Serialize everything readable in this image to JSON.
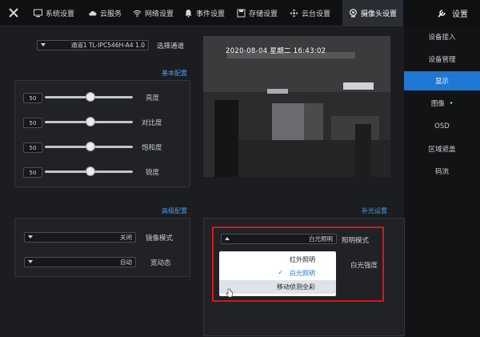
{
  "window": {
    "title": "设置"
  },
  "tabs": [
    {
      "label": "摄像头设置",
      "icon": "camera-icon",
      "active": true
    },
    {
      "label": "云台设置",
      "icon": "ptz-icon",
      "active": false
    },
    {
      "label": "存储设置",
      "icon": "storage-icon",
      "active": false
    },
    {
      "label": "事件设置",
      "icon": "bell-icon",
      "active": false
    },
    {
      "label": "网络设置",
      "icon": "wifi-icon",
      "active": false
    },
    {
      "label": "云服务",
      "icon": "cloud-icon",
      "active": false
    },
    {
      "label": "系统设置",
      "icon": "monitor-icon",
      "active": false
    }
  ],
  "sidebar": {
    "items": [
      {
        "label": "设备接入",
        "active": false
      },
      {
        "label": "设备管理",
        "active": false
      },
      {
        "label": "显示",
        "active": true
      },
      {
        "label": "图像",
        "active": false
      },
      {
        "label": "OSD",
        "active": false
      },
      {
        "label": "区域遮盖",
        "active": false
      },
      {
        "label": "码流",
        "active": false
      }
    ]
  },
  "channel": {
    "label": "选择通道",
    "value": "通道1 TL-IPC546H-A4 1.0"
  },
  "basic": {
    "heading": "基本配置",
    "sliders": [
      {
        "label": "亮度",
        "value": "50",
        "level": 0.5
      },
      {
        "label": "对比度",
        "value": "50",
        "level": 0.5
      },
      {
        "label": "饱和度",
        "value": "50",
        "level": 0.5
      },
      {
        "label": "锐度",
        "value": "50",
        "level": 0.5
      }
    ]
  },
  "advanced": {
    "heading": "高级配置",
    "mirror": {
      "label": "镜像模式",
      "value": "关闭"
    },
    "wdr": {
      "label": "宽动态",
      "value": "自动"
    }
  },
  "fill_light": {
    "heading": "补光设置",
    "mode_label": "照明模式",
    "mode_value": "白光照明",
    "intensity_label": "白光强度",
    "options": [
      "红外照明",
      "白光照明",
      "移动侦测全彩"
    ],
    "selected_index": 1
  },
  "camera": {
    "timestamp": "2020-08-04 星期二 16:43:02"
  },
  "colors": {
    "accent": "#1f78d1",
    "highlight": "#d7161c"
  }
}
